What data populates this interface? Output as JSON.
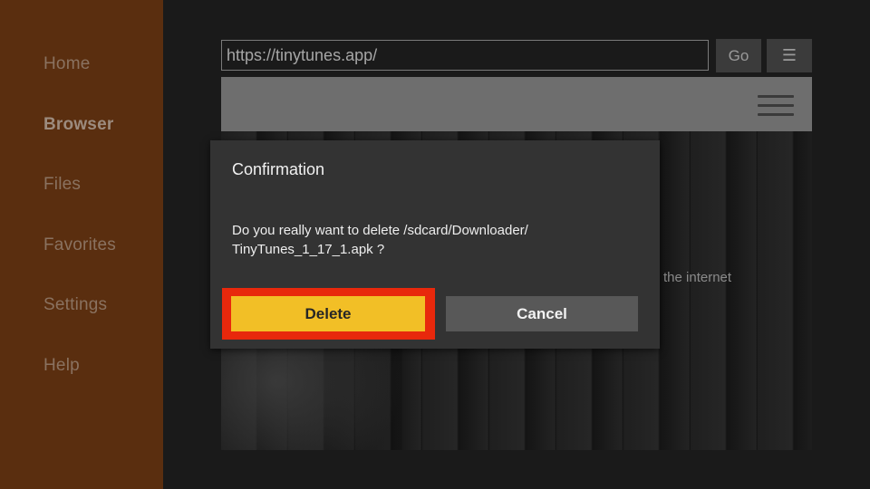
{
  "sidebar": {
    "items": [
      {
        "label": "Home"
      },
      {
        "label": "Browser"
      },
      {
        "label": "Files"
      },
      {
        "label": "Favorites"
      },
      {
        "label": "Settings"
      },
      {
        "label": "Help"
      }
    ],
    "active": "Browser"
  },
  "browser": {
    "url": "https://tinytunes.app/",
    "go_label": "Go",
    "menu_icon": "menu-lines-icon",
    "page_text": "the internet"
  },
  "dialog": {
    "title": "Confirmation",
    "message_line1": "Do you really want to delete /sdcard/Downloader/",
    "message_line2": "TinyTunes_1_17_1.apk ?",
    "delete_label": "Delete",
    "cancel_label": "Cancel"
  },
  "colors": {
    "sidebar_bg": "#5a2e0f",
    "delete_button": "#f2bf26",
    "highlight_border": "#e8280c"
  }
}
